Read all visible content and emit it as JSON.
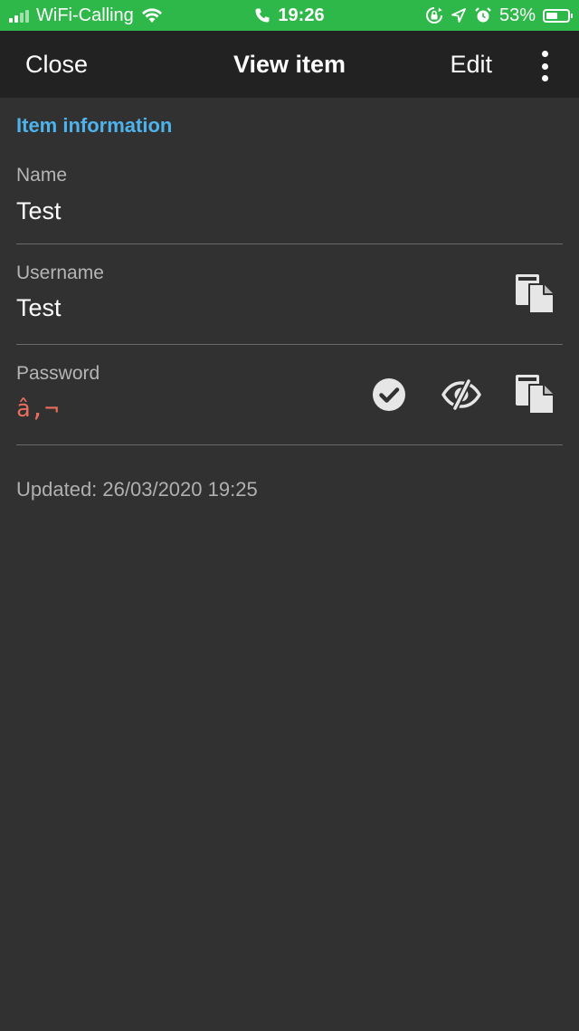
{
  "status_bar": {
    "carrier": "WiFi-Calling",
    "time": "19:26",
    "battery_percent": "53%",
    "battery_level": 0.53,
    "icons": [
      "signal-bars-icon",
      "wifi-icon",
      "phone-icon",
      "screen-lock-icon",
      "location-icon",
      "alarm-icon",
      "battery-icon"
    ]
  },
  "nav": {
    "close_label": "Close",
    "title": "View item",
    "edit_label": "Edit",
    "more_icon": "more-vertical-icon"
  },
  "item": {
    "section_title": "Item information",
    "name_label": "Name",
    "name_value": "Test",
    "username_label": "Username",
    "username_value": "Test",
    "password_label": "Password",
    "password_value": "â‚¬",
    "updated": "Updated: 26/03/2020 19:25"
  },
  "icons": {
    "username_copy": "copy-icon",
    "password_check": "check-circle-icon",
    "password_toggle": "eye-slash-icon",
    "password_copy": "copy-icon"
  },
  "colors": {
    "status_bar": "#2fb84a",
    "nav_bar": "#222222",
    "background": "#313131",
    "accent": "#4eb3ec",
    "password_text": "#e96e5e"
  }
}
